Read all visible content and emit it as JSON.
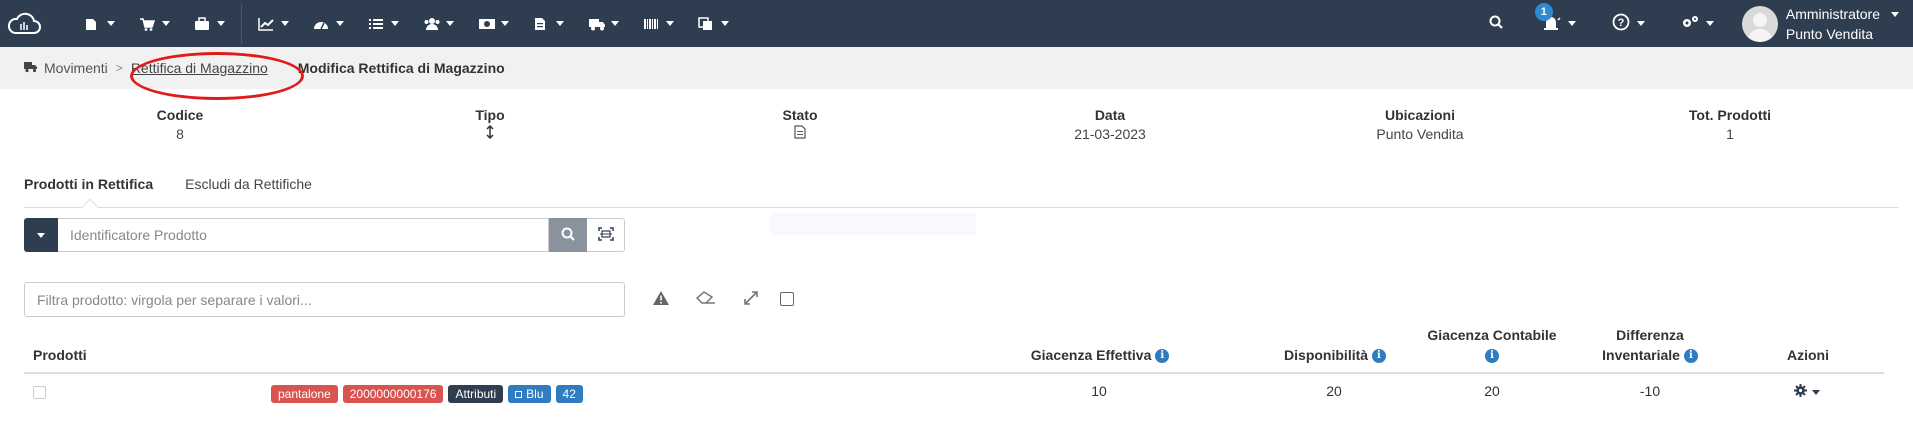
{
  "nav": {
    "items": [
      {
        "name": "nav-documents",
        "icon": "document-icon"
      },
      {
        "name": "nav-cart",
        "icon": "cart-icon"
      },
      {
        "name": "nav-briefcase",
        "icon": "briefcase-icon"
      },
      {
        "name": "nav-charts",
        "icon": "chart-icon"
      },
      {
        "name": "nav-dashboard",
        "icon": "gauge-icon"
      },
      {
        "name": "nav-list",
        "icon": "list-icon"
      },
      {
        "name": "nav-users",
        "icon": "users-icon"
      },
      {
        "name": "nav-money",
        "icon": "money-icon"
      },
      {
        "name": "nav-file",
        "icon": "file-icon"
      },
      {
        "name": "nav-truck",
        "icon": "truck-icon"
      },
      {
        "name": "nav-barcode",
        "icon": "barcode-icon"
      },
      {
        "name": "nav-copy",
        "icon": "copy-icon"
      }
    ],
    "notification_count": "1",
    "user_name": "Amministratore",
    "user_store": "Punto Vendita",
    "bg_color": "#2e3d4f"
  },
  "breadcrumb": {
    "root": "Movimenti",
    "parent": "Rettifica di Magazzino",
    "current": "Modifica Rettifica di Magazzino"
  },
  "summary": {
    "codice_label": "Codice",
    "codice_value": "8",
    "tipo_label": "Tipo",
    "stato_label": "Stato",
    "data_label": "Data",
    "data_value": "21-03-2023",
    "ubicazioni_label": "Ubicazioni",
    "ubicazioni_value": "Punto Vendita",
    "tot_label": "Tot. Prodotti",
    "tot_value": "1"
  },
  "tabs": {
    "in_rettifica": "Prodotti in Rettifica",
    "escludi": "Escludi da Rettifiche"
  },
  "search": {
    "placeholder": "Identificatore Prodotto"
  },
  "filter": {
    "placeholder": "Filtra prodotto: virgola per separare i valori..."
  },
  "table": {
    "headers": {
      "prodotti": "Prodotti",
      "giacenza_effettiva": "Giacenza Effettiva",
      "disponibilita": "Disponibilità",
      "giacenza_contabile_1": "Giacenza Contabile",
      "differenza_1": "Differenza",
      "differenza_2": "Inventariale",
      "azioni": "Azioni"
    },
    "rows": [
      {
        "tags": [
          {
            "text": "pantalone",
            "color": "#d9534f"
          },
          {
            "text": "2000000000176",
            "color": "#d9534f"
          },
          {
            "text": "Attributi",
            "color": "#2e3d4f"
          },
          {
            "text": "Blu",
            "color": "#2f7cc0"
          },
          {
            "text": "42",
            "color": "#2f7cc0"
          }
        ],
        "giacenza_effettiva": "10",
        "disponibilita": "20",
        "giacenza_contabile": "20",
        "differenza": "-10"
      }
    ]
  }
}
